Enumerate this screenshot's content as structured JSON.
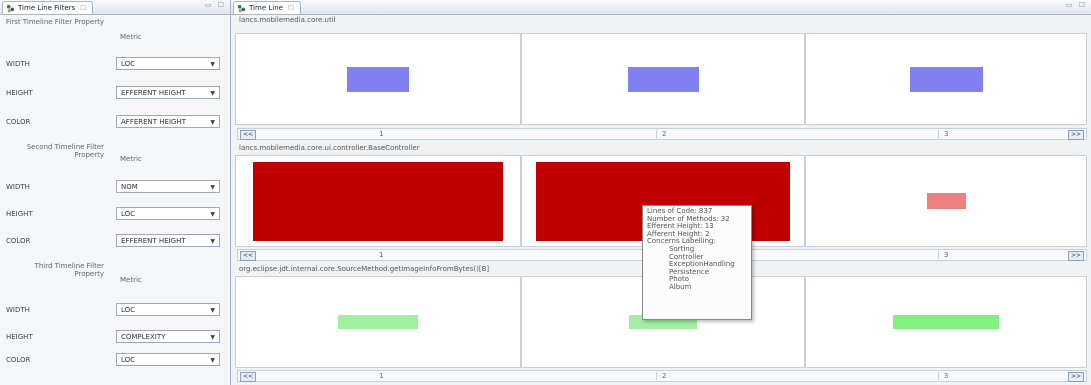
{
  "left_panel": {
    "tab_title": "Time Line Filters",
    "tab_close": "☐",
    "window_controls": "▭ ☐",
    "metric_header": "Metric",
    "filters": [
      {
        "title": "First Timeline Filter Property",
        "width_label": "WIDTH",
        "width_value": "LOC",
        "height_label": "HEIGHT",
        "height_value": "EFFERENT HEIGHT",
        "color_label": "COLOR",
        "color_value": "AFFERENT HEIGHT"
      },
      {
        "title": "Second Timeline Filter Property",
        "width_label": "WIDTH",
        "width_value": "NOM",
        "height_label": "HEIGHT",
        "height_value": "LOC",
        "color_label": "COLOR",
        "color_value": "EFFERENT HEIGHT"
      },
      {
        "title": "Third Timeline Filter Property",
        "width_label": "WIDTH",
        "width_value": "LOC",
        "height_label": "HEIGHT",
        "height_value": "COMPLEXITY",
        "color_label": "COLOR",
        "color_value": "LOC"
      }
    ]
  },
  "timeline": {
    "tab_title": "Time Line",
    "tab_close": "☐",
    "window_controls": "▭ ☐",
    "prev_label": "<<",
    "next_label": ">>",
    "rows": [
      {
        "title": "lancs.mobilemedia.core.util",
        "columns": [
          "1",
          "2",
          "3"
        ],
        "bars": [
          {
            "color": "#8080f0",
            "w_frac": 0.22,
            "h_frac": 0.28
          },
          {
            "color": "#8080f0",
            "w_frac": 0.25,
            "h_frac": 0.28
          },
          {
            "color": "#8080f0",
            "w_frac": 0.26,
            "h_frac": 0.28
          }
        ]
      },
      {
        "title": "lancs.mobilemedia.core.ui.controller.BaseController",
        "columns": [
          "1",
          "2",
          "3"
        ],
        "bars": [
          {
            "color": "#c00000",
            "w_frac": 0.88,
            "h_frac": 0.88
          },
          {
            "color": "#c00000",
            "w_frac": 0.9,
            "h_frac": 0.88
          },
          {
            "color": "#f08080",
            "w_frac": 0.14,
            "h_frac": 0.18
          }
        ]
      },
      {
        "title": "org.eclipse.jdt.internal.core.SourceMethod.getImageInfoFromBytes()[B]",
        "columns": [
          "1",
          "2",
          "3"
        ],
        "bars": [
          {
            "color": "#a0f0a0",
            "w_frac": 0.28,
            "h_frac": 0.16
          },
          {
            "color": "#a0f0a0",
            "w_frac": 0.24,
            "h_frac": 0.16
          },
          {
            "color": "#80f080",
            "w_frac": 0.38,
            "h_frac": 0.16
          }
        ]
      }
    ]
  },
  "tooltip": {
    "lines": [
      "Lines of Code: 837",
      "Number of Methods: 32",
      "Efferent Height: 13",
      "Afferent Height: 2",
      "Concerns Labelling:"
    ],
    "concerns": [
      "Sorting",
      "Controller",
      "ExceptionHandling",
      "Persistence",
      "Photo",
      "Album"
    ]
  }
}
